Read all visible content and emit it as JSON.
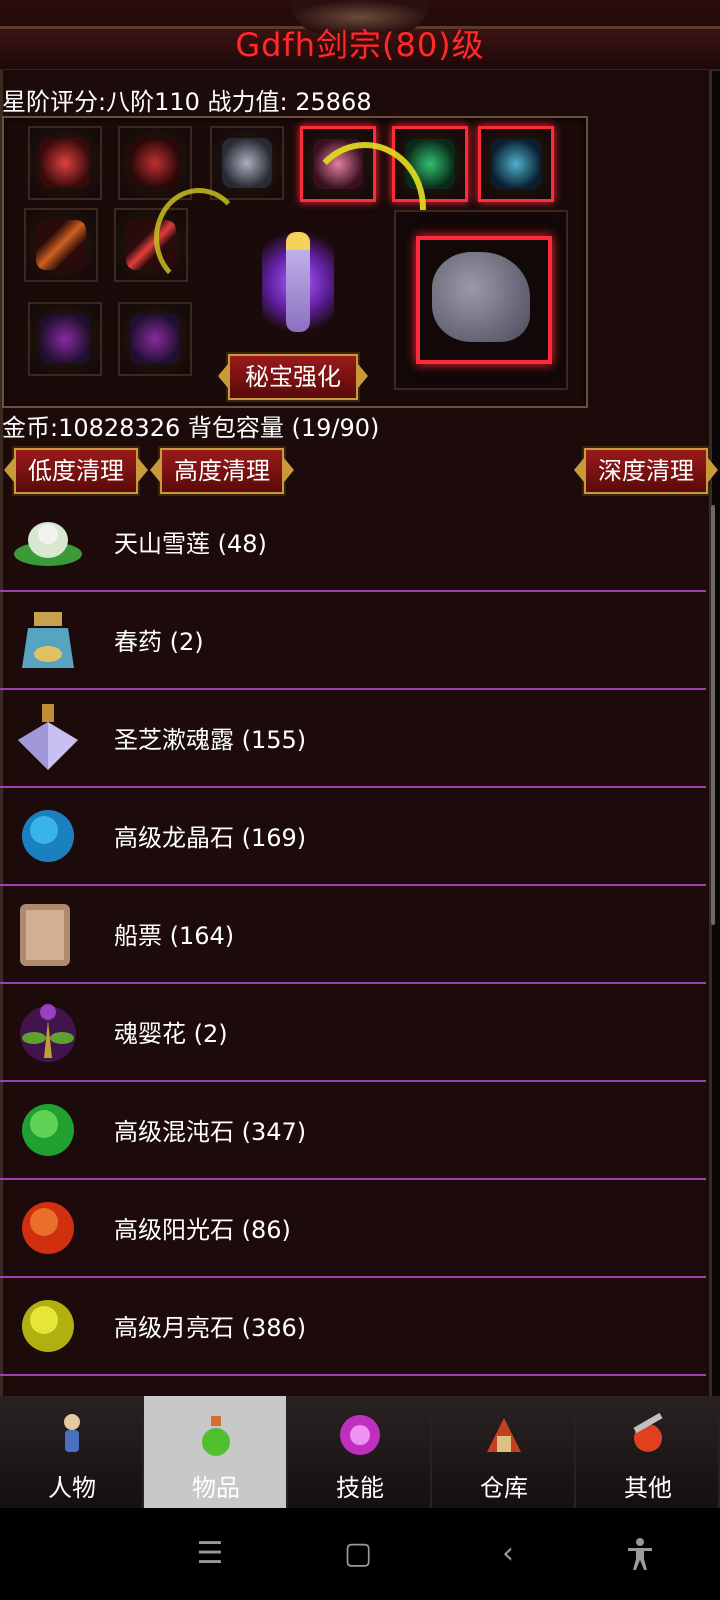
{
  "header": {
    "title": "Gdfh剑宗(80)级"
  },
  "stats": {
    "line": "星阶评分:八阶110 战力值: 25868"
  },
  "equipment": {
    "enhance_button": "秘宝强化"
  },
  "inventory": {
    "gold_line": "金币:10828326 背包容量 (19/90)",
    "buttons": {
      "low_clean": "低度清理",
      "high_clean": "高度清理",
      "deep_clean": "深度清理"
    },
    "items": [
      {
        "name": "天山雪莲 (48)",
        "icon": "snow-lotus-icon"
      },
      {
        "name": "春药 (2)",
        "icon": "potion-bottle-icon"
      },
      {
        "name": "圣芝漱魂露 (155)",
        "icon": "crystal-flask-icon"
      },
      {
        "name": "高级龙晶石 (169)",
        "icon": "blue-orb-icon"
      },
      {
        "name": "船票 (164)",
        "icon": "scroll-icon"
      },
      {
        "name": "魂婴花 (2)",
        "icon": "purple-flower-icon"
      },
      {
        "name": "高级混沌石 (347)",
        "icon": "green-orb-icon"
      },
      {
        "name": "高级阳光石 (86)",
        "icon": "red-orb-icon"
      },
      {
        "name": "高级月亮石 (386)",
        "icon": "yellow-orb-icon"
      }
    ]
  },
  "tabs": [
    {
      "label": "人物",
      "icon": "character-icon"
    },
    {
      "label": "物品",
      "icon": "items-icon"
    },
    {
      "label": "技能",
      "icon": "skill-icon"
    },
    {
      "label": "仓库",
      "icon": "warehouse-icon"
    },
    {
      "label": "其他",
      "icon": "other-icon"
    }
  ],
  "active_tab": "物品",
  "system_nav": {
    "menu": "menu-icon",
    "home": "home-icon",
    "back": "back-icon",
    "accessibility": "accessibility-icon"
  }
}
